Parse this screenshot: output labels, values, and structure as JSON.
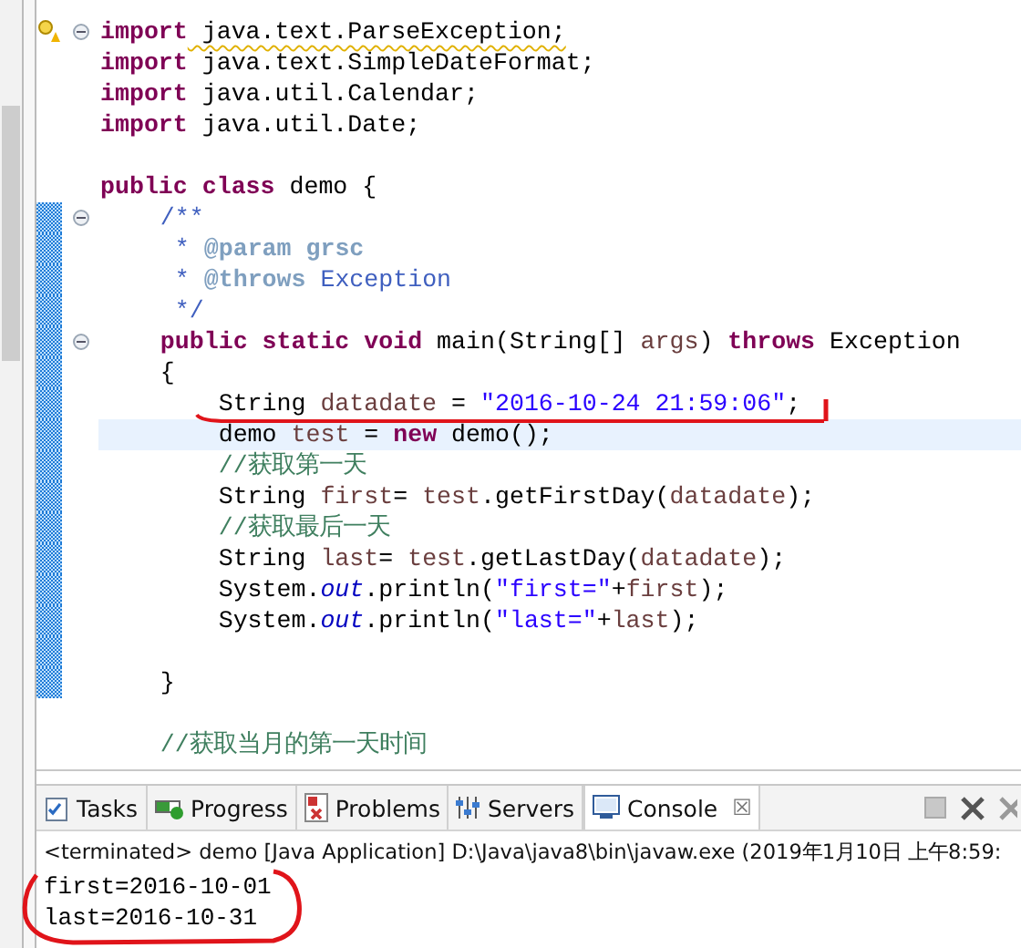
{
  "editor": {
    "lines": [
      {
        "tokens": [
          {
            "text": "import",
            "kind": "keyword"
          },
          {
            "text": " java.text.ParseException;",
            "kind": "plain"
          }
        ],
        "current": false,
        "changed": false,
        "foldable": true,
        "warning": true
      },
      {
        "tokens": [
          {
            "text": "import",
            "kind": "keyword"
          },
          {
            "text": " java.text.SimpleDateFormat;",
            "kind": "plain"
          }
        ],
        "current": false,
        "changed": false,
        "foldable": false,
        "warning": false
      },
      {
        "tokens": [
          {
            "text": "import",
            "kind": "keyword"
          },
          {
            "text": " java.util.Calendar;",
            "kind": "plain"
          }
        ],
        "current": false,
        "changed": false,
        "foldable": false,
        "warning": false
      },
      {
        "tokens": [
          {
            "text": "import",
            "kind": "keyword"
          },
          {
            "text": " java.util.Date;",
            "kind": "plain"
          }
        ],
        "current": false,
        "changed": false,
        "foldable": false,
        "warning": false
      },
      {
        "current": false,
        "changed": false,
        "foldable": false,
        "warning": false
      },
      {
        "tokens": [
          {
            "text": "public class",
            "kind": "keyword"
          },
          {
            "text": " demo {",
            "kind": "plain"
          }
        ],
        "current": false,
        "changed": false,
        "foldable": false,
        "warning": false
      },
      {
        "tokens": [
          {
            "text": "    /**",
            "kind": "doc"
          }
        ],
        "current": false,
        "changed": true,
        "foldable": true,
        "warning": false
      },
      {
        "tokens": [
          {
            "text": "     * ",
            "kind": "doc"
          },
          {
            "text": "@param",
            "kind": "doc-tag"
          },
          {
            "text": " grsc",
            "kind": "doc-tag"
          }
        ],
        "current": false,
        "changed": true,
        "foldable": false,
        "warning": false
      },
      {
        "tokens": [
          {
            "text": "     * ",
            "kind": "doc"
          },
          {
            "text": "@throws",
            "kind": "doc-tag"
          },
          {
            "text": " Exception",
            "kind": "doc"
          }
        ],
        "current": false,
        "changed": true,
        "foldable": false,
        "warning": false
      },
      {
        "tokens": [
          {
            "text": "     */",
            "kind": "doc"
          }
        ],
        "current": false,
        "changed": true,
        "foldable": false,
        "warning": false
      },
      {
        "tokens": [
          {
            "text": "    public static void",
            "kind": "keyword"
          },
          {
            "text": " main(String[] ",
            "kind": "plain"
          },
          {
            "text": "args",
            "kind": "local"
          },
          {
            "text": ") ",
            "kind": "plain"
          },
          {
            "text": "throws",
            "kind": "keyword"
          },
          {
            "text": " Exception",
            "kind": "plain"
          }
        ],
        "current": false,
        "changed": true,
        "foldable": true,
        "warning": false
      },
      {
        "tokens": [
          {
            "text": "    {",
            "kind": "plain"
          }
        ],
        "current": false,
        "changed": true,
        "foldable": false,
        "warning": false
      },
      {
        "tokens": [
          {
            "text": "        String ",
            "kind": "plain"
          },
          {
            "text": "datadate",
            "kind": "local"
          },
          {
            "text": " = ",
            "kind": "plain"
          },
          {
            "text": "\"2016-10-24 21:59:06\"",
            "kind": "string"
          },
          {
            "text": ";",
            "kind": "plain"
          }
        ],
        "current": false,
        "changed": true,
        "foldable": false,
        "warning": false
      },
      {
        "tokens": [
          {
            "text": "        demo ",
            "kind": "plain"
          },
          {
            "text": "test",
            "kind": "local"
          },
          {
            "text": " = ",
            "kind": "plain"
          },
          {
            "text": "new",
            "kind": "keyword"
          },
          {
            "text": " demo();",
            "kind": "plain"
          }
        ],
        "current": true,
        "changed": true,
        "foldable": false,
        "warning": false
      },
      {
        "tokens": [
          {
            "text": "        //获取第一天",
            "kind": "comment"
          }
        ],
        "current": false,
        "changed": true,
        "foldable": false,
        "warning": false
      },
      {
        "tokens": [
          {
            "text": "        String ",
            "kind": "plain"
          },
          {
            "text": "first",
            "kind": "local"
          },
          {
            "text": "= ",
            "kind": "plain"
          },
          {
            "text": "test",
            "kind": "local"
          },
          {
            "text": ".getFirstDay(",
            "kind": "plain"
          },
          {
            "text": "datadate",
            "kind": "local"
          },
          {
            "text": ");",
            "kind": "plain"
          }
        ],
        "current": false,
        "changed": true,
        "foldable": false,
        "warning": false
      },
      {
        "tokens": [
          {
            "text": "        //获取最后一天",
            "kind": "comment"
          }
        ],
        "current": false,
        "changed": true,
        "foldable": false,
        "warning": false
      },
      {
        "tokens": [
          {
            "text": "        String ",
            "kind": "plain"
          },
          {
            "text": "last",
            "kind": "local"
          },
          {
            "text": "= ",
            "kind": "plain"
          },
          {
            "text": "test",
            "kind": "local"
          },
          {
            "text": ".getLastDay(",
            "kind": "plain"
          },
          {
            "text": "datadate",
            "kind": "local"
          },
          {
            "text": ");",
            "kind": "plain"
          }
        ],
        "current": false,
        "changed": true,
        "foldable": false,
        "warning": false
      },
      {
        "tokens": [
          {
            "text": "        System.",
            "kind": "plain"
          },
          {
            "text": "out",
            "kind": "field"
          },
          {
            "text": ".println(",
            "kind": "plain"
          },
          {
            "text": "\"first=\"",
            "kind": "string"
          },
          {
            "text": "+",
            "kind": "plain"
          },
          {
            "text": "first",
            "kind": "local"
          },
          {
            "text": ");",
            "kind": "plain"
          }
        ],
        "current": false,
        "changed": true,
        "foldable": false,
        "warning": false
      },
      {
        "tokens": [
          {
            "text": "        System.",
            "kind": "plain"
          },
          {
            "text": "out",
            "kind": "field"
          },
          {
            "text": ".println(",
            "kind": "plain"
          },
          {
            "text": "\"last=\"",
            "kind": "string"
          },
          {
            "text": "+",
            "kind": "plain"
          },
          {
            "text": "last",
            "kind": "local"
          },
          {
            "text": ");",
            "kind": "plain"
          }
        ],
        "current": false,
        "changed": true,
        "foldable": false,
        "warning": false
      },
      {
        "current": false,
        "changed": true,
        "foldable": false,
        "warning": false
      },
      {
        "tokens": [
          {
            "text": "    }",
            "kind": "plain"
          }
        ],
        "current": false,
        "changed": true,
        "foldable": false,
        "warning": false
      },
      {
        "current": false,
        "changed": false,
        "foldable": false,
        "warning": false
      },
      {
        "tokens": [
          {
            "text": "    //获取当月的第一天时间",
            "kind": "comment"
          }
        ],
        "current": false,
        "changed": false,
        "foldable": false,
        "warning": false
      }
    ]
  },
  "bottom_panel": {
    "tabs": [
      {
        "label": "Tasks",
        "kind": "tasks",
        "selected": false
      },
      {
        "label": "Progress",
        "kind": "progress",
        "selected": false
      },
      {
        "label": "Problems",
        "kind": "problems",
        "selected": false
      },
      {
        "label": "Servers",
        "kind": "servers",
        "selected": false
      },
      {
        "label": "Console",
        "kind": "console",
        "selected": true,
        "close": "☒"
      }
    ],
    "console": {
      "header": "<terminated> demo [Java Application] D:\\Java\\java8\\bin\\javaw.exe (2019年1月10日 上午8:59:",
      "output": [
        "first=2016-10-01",
        "last=2016-10-31"
      ]
    }
  }
}
